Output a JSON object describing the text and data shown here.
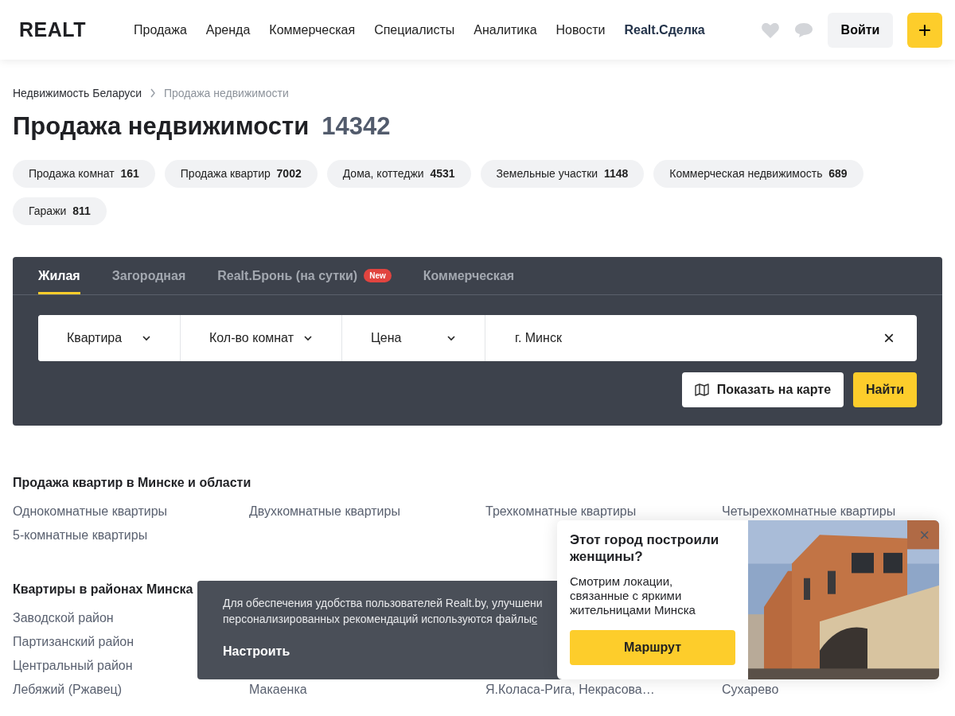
{
  "header": {
    "logo": "REALT",
    "nav": [
      {
        "label": "Продажа",
        "highlight": false
      },
      {
        "label": "Аренда",
        "highlight": false
      },
      {
        "label": "Коммерческая",
        "highlight": false
      },
      {
        "label": "Специалисты",
        "highlight": false
      },
      {
        "label": "Аналитика",
        "highlight": false
      },
      {
        "label": "Новости",
        "highlight": false
      },
      {
        "label": "Realt.Сделка",
        "highlight": true
      }
    ],
    "login": "Войти",
    "add": "+"
  },
  "breadcrumbs": [
    {
      "label": "Недвижимость Беларуси",
      "current": false
    },
    {
      "label": "Продажа недвижимости",
      "current": true
    }
  ],
  "title": "Продажа недвижимости",
  "total": "14342",
  "chips": [
    {
      "label": "Продажа комнат",
      "count": "161"
    },
    {
      "label": "Продажа квартир",
      "count": "7002"
    },
    {
      "label": "Дома, коттеджи",
      "count": "4531"
    },
    {
      "label": "Земельные участки",
      "count": "1148"
    },
    {
      "label": "Коммерческая недвижимость",
      "count": "689"
    },
    {
      "label": "Гаражи",
      "count": "811"
    }
  ],
  "search": {
    "tabs": [
      {
        "label": "Жилая",
        "selected": true
      },
      {
        "label": "Загородная",
        "selected": false
      },
      {
        "label": "Realt.Бронь (на сутки)",
        "selected": false,
        "badge": "New"
      },
      {
        "label": "Коммерческая",
        "selected": false
      }
    ],
    "filters": [
      {
        "kind": "dropdown",
        "label": "Квартира"
      },
      {
        "kind": "dropdown",
        "label": "Кол-во комнат"
      },
      {
        "kind": "dropdown",
        "label": "Цена"
      },
      {
        "kind": "location",
        "value": "г. Минск",
        "clear": "×"
      }
    ],
    "map_button": "Показать на карте",
    "find_button": "Найти"
  },
  "sections": [
    {
      "title": "Продажа квартир в Минске и области",
      "rows": [
        [
          "Однокомнатные квартиры",
          "Двухкомнатные квартиры",
          "Трехкомнатные квартиры",
          "Четырехкомнатные квартиры"
        ],
        [
          "5-комнатные квартиры"
        ]
      ]
    },
    {
      "title": "Квартиры в районах Минска",
      "rows": [
        [
          "Заводской район"
        ],
        [
          "Партизанский район"
        ],
        [
          "Центральный район"
        ],
        [
          "Лебяжий (Ржавец)",
          "Макаенка",
          "Я.Коласа-Рига, Некрасова…",
          "Сухарево"
        ]
      ]
    }
  ],
  "cookie": {
    "line_1": "Для обеспечения удобства пользователей Realt.by, улучшени",
    "line_2": "персонализированных рекомендаций используются файлы",
    "link": "c",
    "settings": "Настроить"
  },
  "promo": {
    "title": "Этот город построили женщины?",
    "text": "Смотрим локации, связанные с яркими жительницами Минска",
    "button": "Маршрут",
    "close": "×"
  }
}
